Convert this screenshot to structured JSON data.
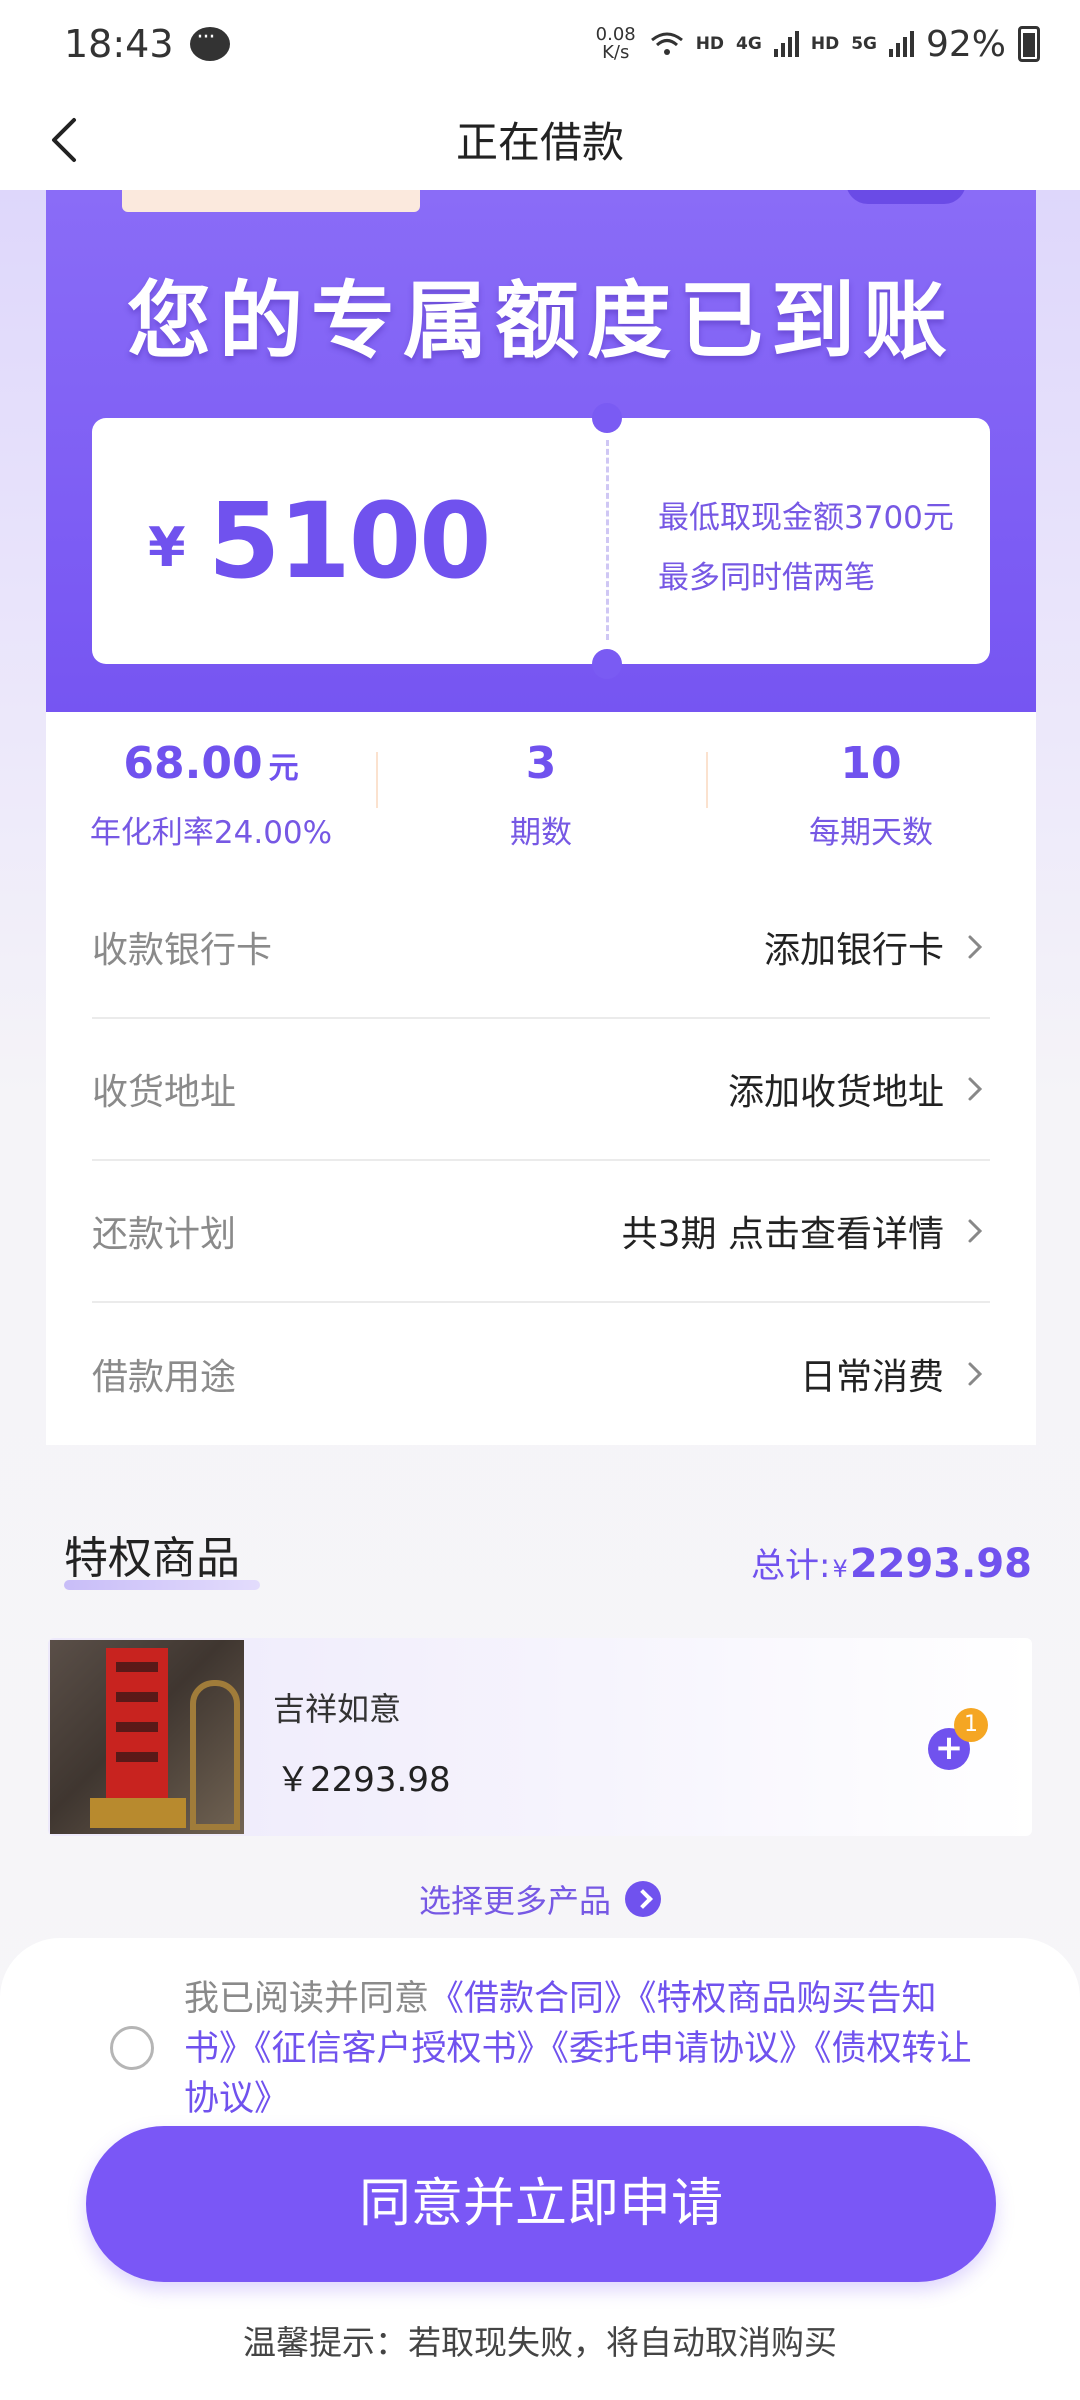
{
  "status_bar": {
    "time": "18:43",
    "net_speed_value": "0.08",
    "net_speed_unit": "K/s",
    "hd1": "HD",
    "net1": "4G",
    "hd2": "HD",
    "net2": "5G",
    "battery": "92%"
  },
  "nav": {
    "title": "正在借款"
  },
  "hero": {
    "title": "您的专属额度已到账",
    "currency": "¥",
    "amount": "5100",
    "note1": "最低取现金额3700元",
    "note2": "最多同时借两笔"
  },
  "stats": [
    {
      "value": "68.00",
      "unit": "元",
      "label": "年化利率24.00%"
    },
    {
      "value": "3",
      "unit": "",
      "label": "期数"
    },
    {
      "value": "10",
      "unit": "",
      "label": "每期天数"
    }
  ],
  "form": [
    {
      "label": "收款银行卡",
      "value": "添加银行卡"
    },
    {
      "label": "收货地址",
      "value": "添加收货地址"
    },
    {
      "label": "还款计划",
      "value": "共3期 点击查看详情"
    },
    {
      "label": "借款用途",
      "value": "日常消费"
    }
  ],
  "goods": {
    "section_title": "特权商品",
    "total_label": "总计:",
    "total_yen": "¥",
    "total_amount": "2293.98",
    "product": {
      "name": "吉祥如意",
      "price": "￥2293.98",
      "quantity": "1"
    },
    "more_label": "选择更多产品"
  },
  "agreement": {
    "prefix": "我已阅读并同意",
    "links": [
      "《借款合同》",
      "《特权商品购买告知书》",
      "《征信客户授权书》",
      "《委托申请协议》",
      "《债权转让协议》"
    ],
    "checked": false
  },
  "apply_button": "同意并立即申请",
  "tip": "温馨提示：若取现失败，将自动取消购买",
  "colors": {
    "accent": "#7052ee",
    "button": "#7a57f6",
    "badge": "#f5a623"
  }
}
